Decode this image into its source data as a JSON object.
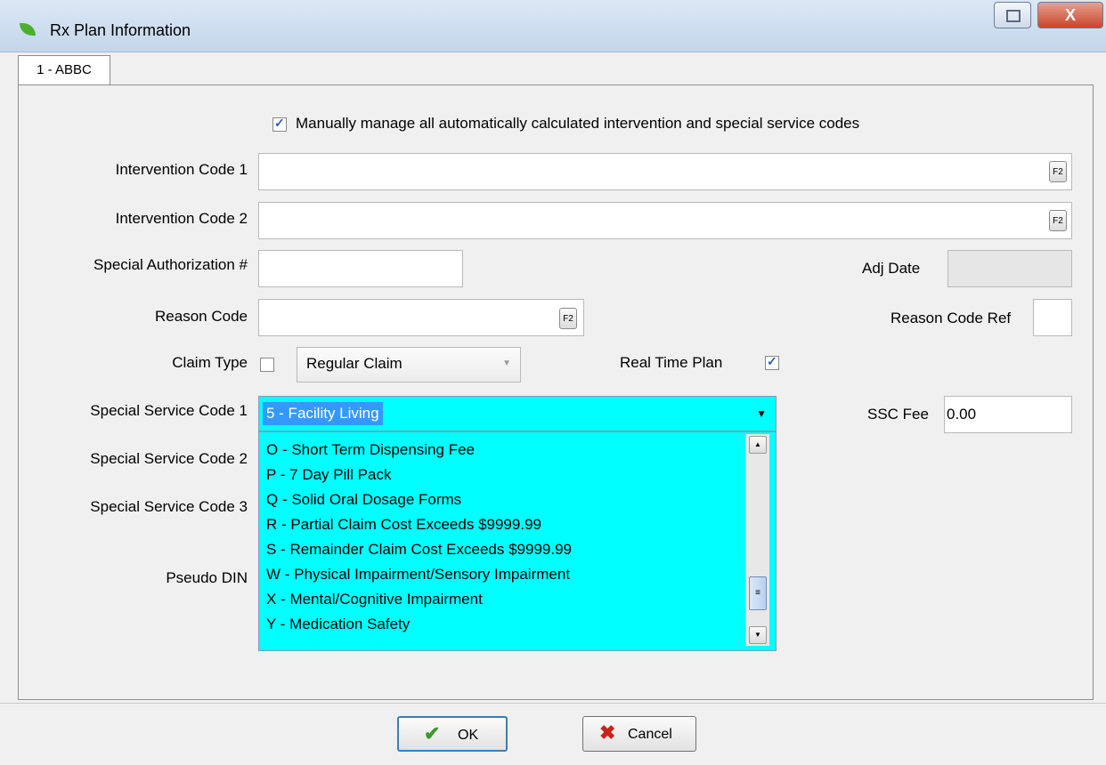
{
  "window": {
    "title": "Rx Plan Information",
    "close_label": "X"
  },
  "tab": {
    "label": "1 - ABBC"
  },
  "form": {
    "manual_manage_label": "Manually manage all automatically calculated intervention and special service codes",
    "manual_manage_checked": true,
    "intervention_code_1_label": "Intervention Code 1",
    "intervention_code_1_value": "",
    "intervention_code_2_label": "Intervention Code 2",
    "intervention_code_2_value": "",
    "special_auth_label": "Special Authorization #",
    "special_auth_value": "",
    "adj_date_label": "Adj Date",
    "adj_date_value": "",
    "reason_code_label": "Reason Code",
    "reason_code_value": "",
    "reason_code_ref_label": "Reason Code Ref",
    "reason_code_ref_value": "",
    "claim_type_label": "Claim Type",
    "claim_type_checked": false,
    "claim_type_value": "Regular Claim",
    "real_time_plan_label": "Real Time Plan",
    "real_time_plan_checked": true,
    "ssc1_label": "Special Service Code 1",
    "ssc1_value": "5 - Facility Living",
    "ssc2_label": "Special Service Code 2",
    "ssc3_label": "Special Service Code 3",
    "pseudo_din_label": "Pseudo DIN",
    "ssc_fee_label": "SSC Fee",
    "ssc_fee_value": "0.00",
    "f2_label": "F2"
  },
  "ssc_options": [
    "O - Short Term Dispensing Fee",
    "P - 7 Day Pill Pack",
    "Q - Solid Oral Dosage Forms",
    "R - Partial Claim Cost Exceeds $9999.99",
    "S - Remainder Claim Cost Exceeds $9999.99",
    "W - Physical Impairment/Sensory Impairment",
    "X - Mental/Cognitive Impairment",
    "Y - Medication Safety"
  ],
  "buttons": {
    "ok": "OK",
    "cancel": "Cancel"
  },
  "colors": {
    "dropdown_bg": "#00ffff",
    "selection": "#3399ff",
    "ok_check": "#3a9a2a",
    "cancel_x": "#c8231a"
  },
  "icons": {
    "app": "leaf-icon",
    "ok": "checkmark-icon",
    "cancel": "x-icon"
  }
}
